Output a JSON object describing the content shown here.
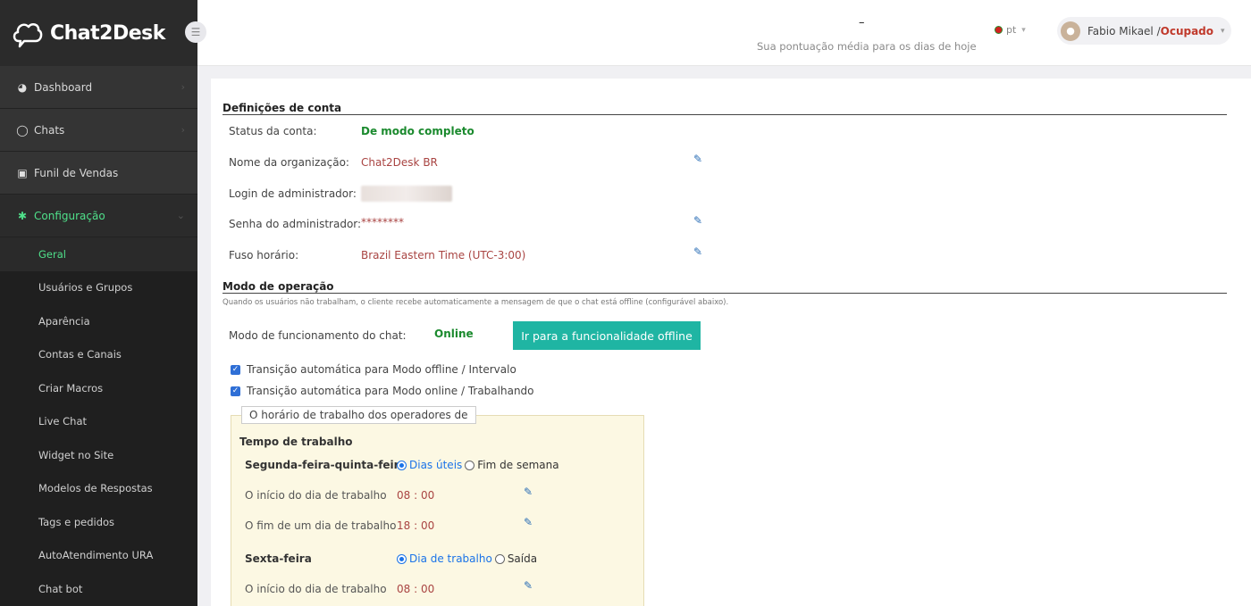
{
  "app": {
    "logo_text": "Chat2Desk"
  },
  "topbar": {
    "score_value": "–",
    "score_text": "Sua pontuação média para os dias de hoje",
    "lang": "pt",
    "user_name": "Fabio Mikael / ",
    "user_status": "Ocupado"
  },
  "sidebar": {
    "items": [
      {
        "label": "Dashboard",
        "icon": "dashboard-icon"
      },
      {
        "label": "Chats",
        "icon": "chat-bubble-icon"
      },
      {
        "label": "Funil de Vendas",
        "icon": "funnel-icon"
      },
      {
        "label": "Configuração",
        "icon": "gear-icon"
      }
    ],
    "subitems": [
      "Geral",
      "Usuários e Grupos",
      "Aparência",
      "Contas e Canais",
      "Criar Macros",
      "Live Chat",
      "Widget no Site",
      "Modelos de Respostas",
      "Tags e pedidos",
      "AutoAtendimento URA",
      "Chat bot"
    ]
  },
  "account": {
    "title": "Definições de conta",
    "status_label": "Status da conta:",
    "status_value": "De modo completo",
    "org_label": "Nome da organização:",
    "org_value": "Chat2Desk BR",
    "login_label": "Login de administrador:",
    "password_label": "Senha do administrador:",
    "password_value": "********",
    "tz_label": "Fuso horário:",
    "tz_value": "Brazil Eastern Time (UTC-3:00)"
  },
  "operation": {
    "title": "Modo de operação",
    "note": "Quando os usuários não trabalham, o cliente recebe automaticamente a mensagem de que o chat está offline (configurável abaixo).",
    "mode_label": "Modo de funcionamento do chat:",
    "mode_value": "Online",
    "offline_button": "Ir para a funcionalidade offline",
    "check1": "Transição automática para Modo offline / Intervalo",
    "check2": "Transição automática para Modo online / Trabalhando"
  },
  "working_hours": {
    "legend": "O horário de trabalho dos operadores de",
    "title": "Tempo de trabalho",
    "mon_thu": {
      "label": "Segunda-feira-quinta-feira",
      "opt1": "Dias úteis",
      "opt2": "Fim de semana",
      "start_label": "O início do dia de trabalho",
      "start_value": "08 : 00",
      "end_label": "O fim de um dia de trabalho",
      "end_value": "18 : 00"
    },
    "fri": {
      "label": "Sexta-feira",
      "opt1": "Dia de trabalho",
      "opt2": "Saída",
      "start_label": "O início do dia de trabalho",
      "start_value": "08 : 00"
    }
  }
}
